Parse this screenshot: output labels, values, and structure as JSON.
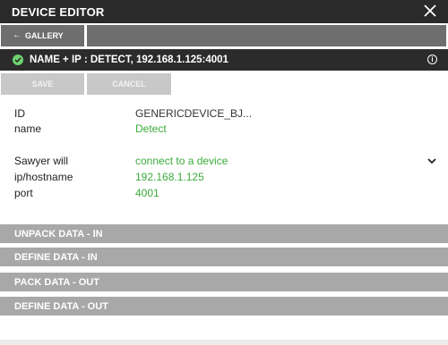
{
  "window": {
    "title": "DEVICE EDITOR",
    "close_icon": "close-icon"
  },
  "nav": {
    "back_label": "GALLERY",
    "back_icon": "←"
  },
  "device_header": {
    "title": "NAME + IP : DETECT, 192.168.1.125:4001",
    "status_color": "#6ed26e",
    "info_icon": "i"
  },
  "actions": {
    "save_label": "SAVE",
    "cancel_label": "CANCEL"
  },
  "fields": {
    "id": {
      "label": "ID",
      "value": "GENERICDEVICE_BJ..."
    },
    "name": {
      "label": "name",
      "value": "Detect"
    },
    "sawyer": {
      "label": "Sawyer will",
      "value": "connect to a device"
    },
    "host": {
      "label": "ip/hostname",
      "value": "192.168.1.125"
    },
    "port": {
      "label": "port",
      "value": "4001"
    }
  },
  "sections": [
    {
      "label": "UNPACK DATA - IN"
    },
    {
      "label": "DEFINE DATA - IN"
    },
    {
      "label": "PACK DATA - OUT"
    },
    {
      "label": "DEFINE DATA - OUT"
    }
  ],
  "colors": {
    "accent_green": "#3cab3c",
    "header_dark": "#2b2b2b",
    "section_gray": "#a8a8a8",
    "button_gray": "#6e6e6e",
    "disabled_gray": "#c8c8c8"
  }
}
